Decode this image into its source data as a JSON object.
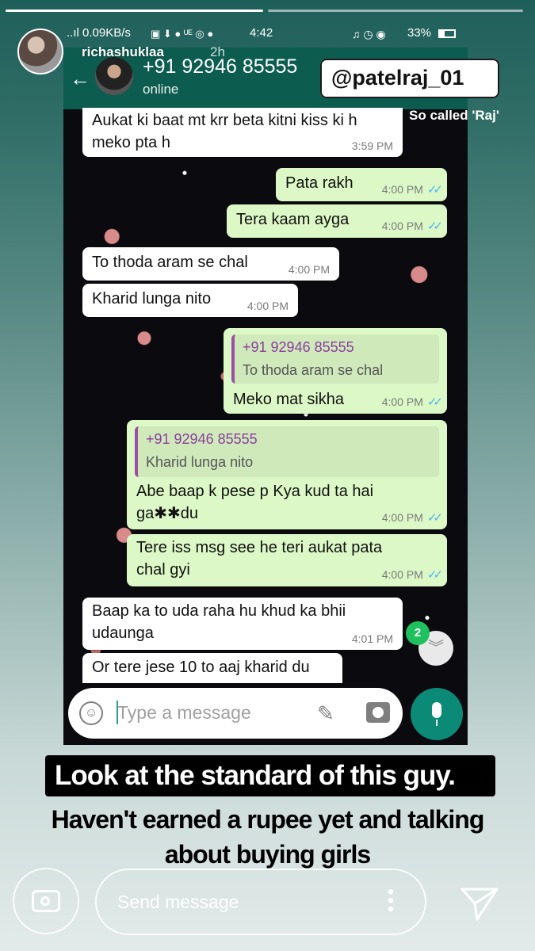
{
  "story": {
    "username": "richashuklaa",
    "time_ago": "2h",
    "send_placeholder": "Send message"
  },
  "status_bar": {
    "left": "..ıl 0.09KB/s",
    "time": "4:42",
    "battery": "33%"
  },
  "whatsapp": {
    "contact_name": "+91 92946 85555",
    "contact_status": "online",
    "input_placeholder": "Type a message",
    "unread_count": "2"
  },
  "overlay": {
    "handle": "@patelraj_01",
    "label": "So called 'Raj'"
  },
  "messages": [
    {
      "dir": "in",
      "text_line1": "Aukat ki baat mt krr beta kitni kiss ki h",
      "text_line2": "meko pta h",
      "time": "3:59 PM"
    },
    {
      "dir": "out",
      "text": "Pata rakh",
      "time": "4:00 PM"
    },
    {
      "dir": "out",
      "text": "Tera kaam ayga",
      "time": "4:00 PM"
    },
    {
      "dir": "in",
      "text": "To thoda aram se chal",
      "time": "4:00 PM"
    },
    {
      "dir": "in",
      "text": "Kharid lunga nito",
      "time": "4:00 PM"
    },
    {
      "dir": "out",
      "quote_name": "+91 92946 85555",
      "quote_text": "To thoda aram se chal",
      "text": "Meko mat sikha",
      "time": "4:00 PM"
    },
    {
      "dir": "out",
      "quote_name": "+91 92946 85555",
      "quote_text": "Kharid lunga nito",
      "text_line1": "Abe baap k pese p Kya kud ta hai",
      "text_line2": "ga✱✱du",
      "time": "4:00 PM"
    },
    {
      "dir": "out",
      "text_line1": "Tere iss msg see he teri aukat pata",
      "text_line2": "chal gyi",
      "time": "4:00 PM"
    },
    {
      "dir": "in",
      "text_line1": "Baap ka to uda raha hu khud ka bhii",
      "text_line2": "udaunga",
      "time": "4:01 PM"
    },
    {
      "dir": "in",
      "text": "Or tere jese 10 to aaj kharid du",
      "time": ""
    }
  ],
  "captions": {
    "line1": "Look at the standard of this guy.",
    "line2a": "Haven't earned a rupee yet and talking",
    "line2b": "about buying girls"
  },
  "icons": [
    "back-arrow-icon",
    "emoji-icon",
    "attach-icon",
    "camera-icon",
    "mic-icon",
    "double-chevron-down-icon",
    "story-camera-icon",
    "more-dots-icon",
    "send-direct-icon",
    "read-ticks-icon"
  ],
  "colors": {
    "whatsapp_header": "#0d5c50",
    "outgoing_bubble": "#dcf8c6",
    "incoming_bubble": "#ffffff",
    "read_ticks": "#4fb6ec",
    "quote_name": "#8b3f9b",
    "unread_badge": "#1fc15e",
    "mic_button": "#0b8a78"
  }
}
